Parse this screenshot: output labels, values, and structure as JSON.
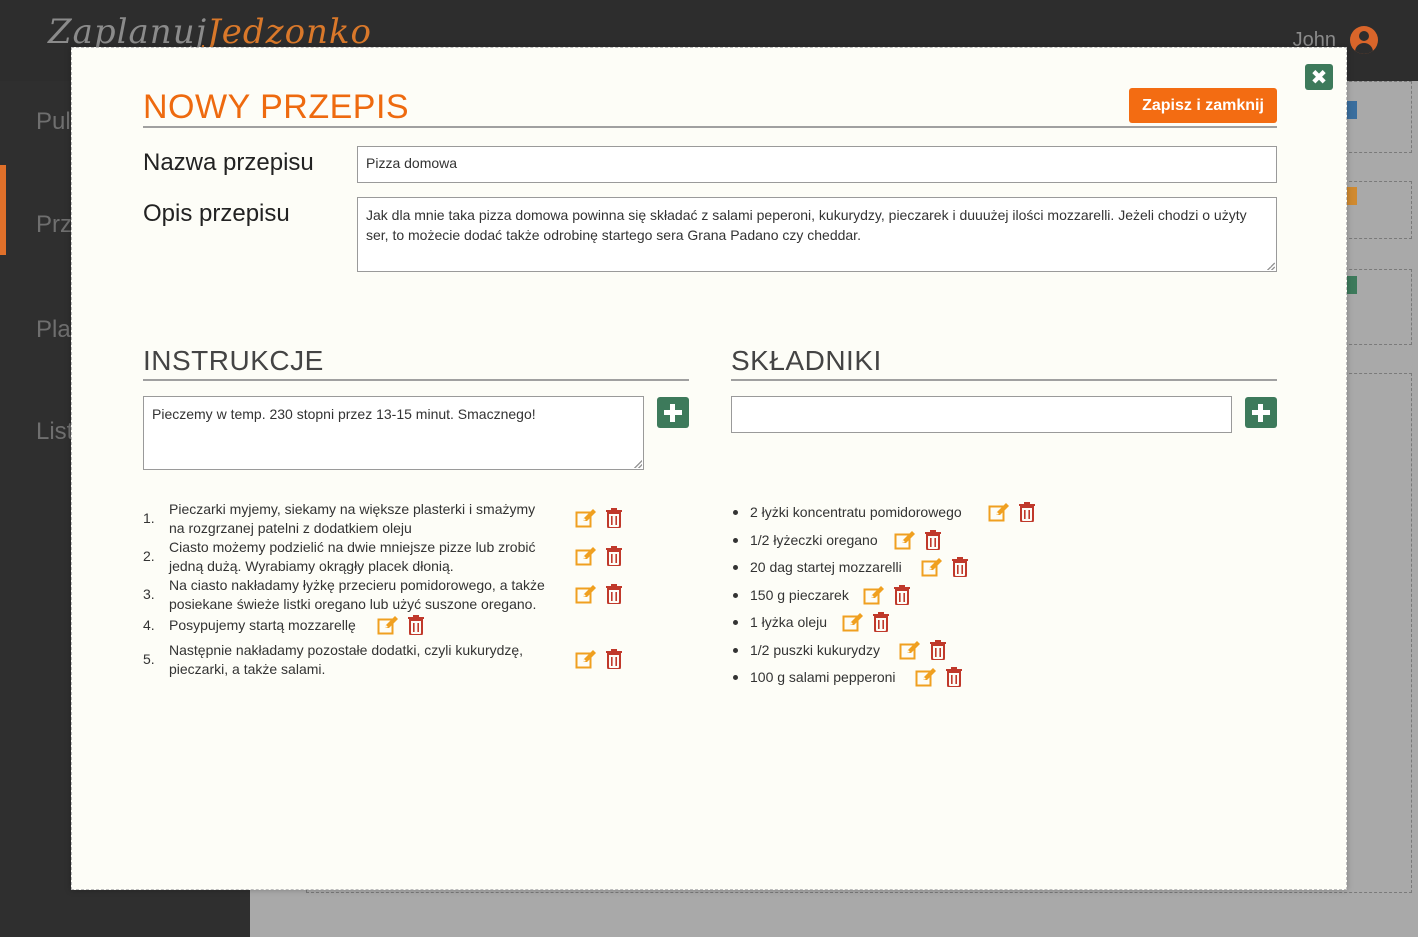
{
  "app": {
    "logo_part1": "Zaplanuj",
    "logo_part2": "Jedzonko",
    "user_name": "John"
  },
  "sidebar": {
    "items": [
      {
        "label": "Pulpit"
      },
      {
        "label": "Przepisy"
      },
      {
        "label": "Plany"
      },
      {
        "label": "Lista zakupów"
      }
    ]
  },
  "modal": {
    "title": "NOWY PRZEPIS",
    "save_label": "Zapisz i zamknij",
    "close_icon": "close-icon",
    "name_label": "Nazwa przepisu",
    "name_value": "Pizza domowa",
    "desc_label": "Opis przepisu",
    "desc_value": "Jak dla mnie taka pizza domowa powinna się składać z salami peperoni, kukurydzy, pieczarek i duuużej ilości mozzarelli. Jeżeli chodzi o użyty ser, to możecie dodać także odrobinę startego sera Grana Padano czy cheddar.",
    "instructions": {
      "title": "INSTRUKCJE",
      "input_value": "Pieczemy w temp. 230 stopni przez 13-15 minut. Smacznego!",
      "steps": [
        {
          "num": "1.",
          "line1": "Pieczarki myjemy, siekamy na większe plasterki i smażymy",
          "line2": "na rozgrzanej patelni z dodatkiem oleju"
        },
        {
          "num": "2.",
          "line1": "Ciasto możemy podzielić na dwie mniejsze pizze lub zrobić",
          "line2": "jedną dużą. Wyrabiamy okrągły placek dłonią."
        },
        {
          "num": "3.",
          "line1": "Na ciasto nakładamy łyżkę przecieru pomidorowego, a także",
          "line2": "posiekane świeże listki oregano lub użyć suszone oregano."
        },
        {
          "num": "4.",
          "line1": "Posypujemy startą mozzarellę",
          "line2": ""
        },
        {
          "num": "5.",
          "line1": "Następnie nakładamy pozostałe dodatki, czyli kukurydzę,",
          "line2": "pieczarki, a także salami."
        }
      ]
    },
    "ingredients": {
      "title": "SKŁADNIKI",
      "input_value": "",
      "items": [
        {
          "label": "2 łyżki koncentratu pomidorowego"
        },
        {
          "label": "1/2 łyżeczki oregano"
        },
        {
          "label": "20 dag startej mozzarelli"
        },
        {
          "label": "150 g pieczarek"
        },
        {
          "label": "1 łyżka oleju"
        },
        {
          "label": "1/2 puszki kukurydzy"
        },
        {
          "label": "100 g salami pepperoni"
        }
      ]
    }
  },
  "colors": {
    "accent": "#f36c12",
    "green": "#3d7a5b",
    "edit": "#f0a020",
    "trash": "#c0392b"
  }
}
